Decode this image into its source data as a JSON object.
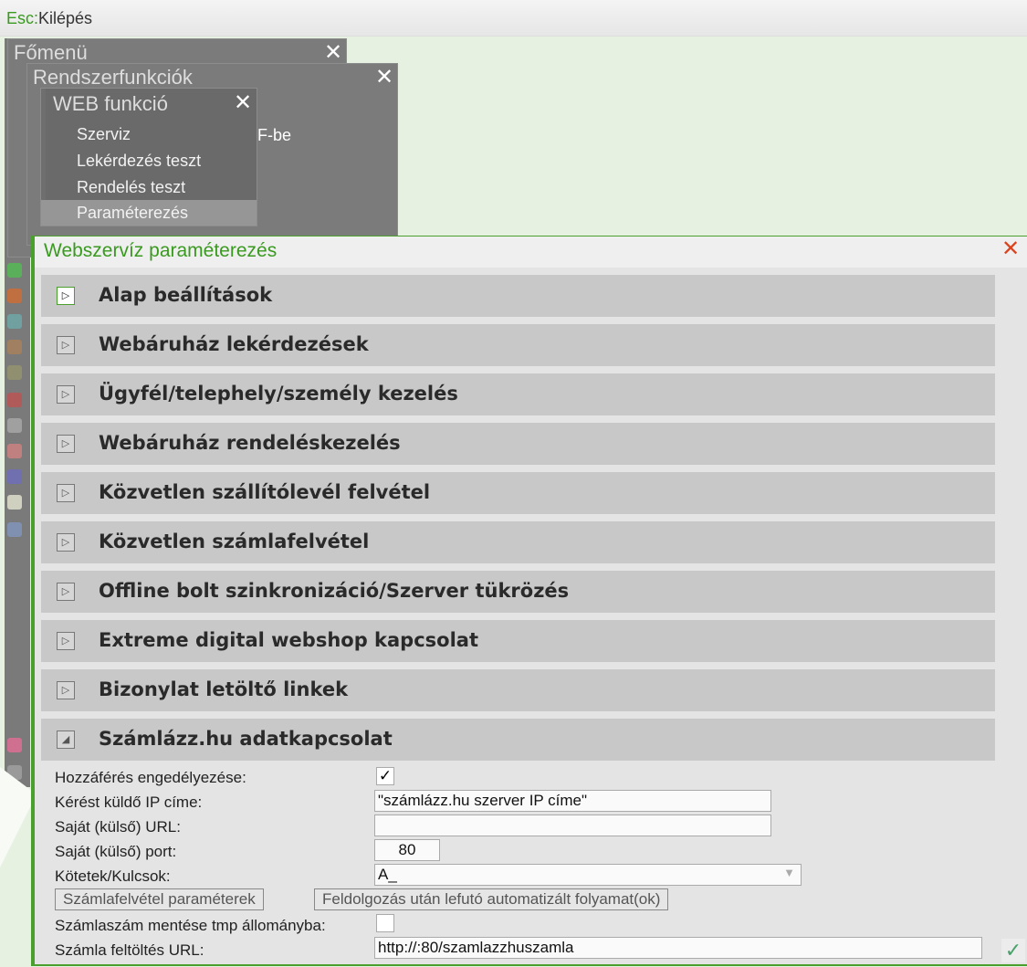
{
  "topbar": {
    "key": "Esc:",
    "label": "Kilépés"
  },
  "windows": {
    "main_menu": {
      "title": "Főmenü"
    },
    "system_functions": {
      "title": "Rendszerfunkciók",
      "partial_text": "F-be"
    },
    "web_function": {
      "title": "WEB funkció",
      "items": [
        "Szerviz",
        "Lekérdezés teszt",
        "Rendelés teszt",
        "Paraméterezés"
      ],
      "selected": "Paraméterezés"
    }
  },
  "panel": {
    "title": "Webszervíz paraméterezés",
    "sections": [
      {
        "label": "Alap beállítások",
        "expanded": false
      },
      {
        "label": "Webáruház lekérdezések",
        "expanded": false
      },
      {
        "label": "Ügyfél/telephely/személy kezelés",
        "expanded": false
      },
      {
        "label": "Webáruház rendeléskezelés",
        "expanded": false
      },
      {
        "label": "Közvetlen szállítólevél felvétel",
        "expanded": false
      },
      {
        "label": "Közvetlen számlafelvétel",
        "expanded": false
      },
      {
        "label": "Offline bolt szinkronizáció/Szerver tükrözés",
        "expanded": false
      },
      {
        "label": "Extreme digital webshop kapcsolat",
        "expanded": false
      },
      {
        "label": "Bizonylat letöltő linkek",
        "expanded": false
      },
      {
        "label": "Számlázz.hu adatkapcsolat",
        "expanded": true
      }
    ],
    "form": {
      "access_label": "Hozzáférés engedélyezése:",
      "access_checked": true,
      "check_mark": "✓",
      "ip_label": "Kérést küldő IP címe:",
      "ip_value": "\"számlázz.hu szerver IP címe\"",
      "url_label": "Saját (külső) URL:",
      "url_value": "",
      "port_label": "Saját (külső) port:",
      "port_value": "80",
      "keys_label": "Kötetek/Kulcsok:",
      "keys_value": "A_",
      "btn_invoice_params": "Számlafelvétel paraméterek",
      "btn_post_process": "Feldolgozás után lefutó automatizált folyamat(ok)",
      "tmp_label": "Számlaszám mentése tmp állományba:",
      "tmp_checked": false,
      "upload_label": "Számla feltöltés URL:",
      "upload_value": "http://:80/szamlazzhuszamla"
    }
  },
  "colors": {
    "accent": "#4aa02c",
    "close": "#d9441f"
  }
}
